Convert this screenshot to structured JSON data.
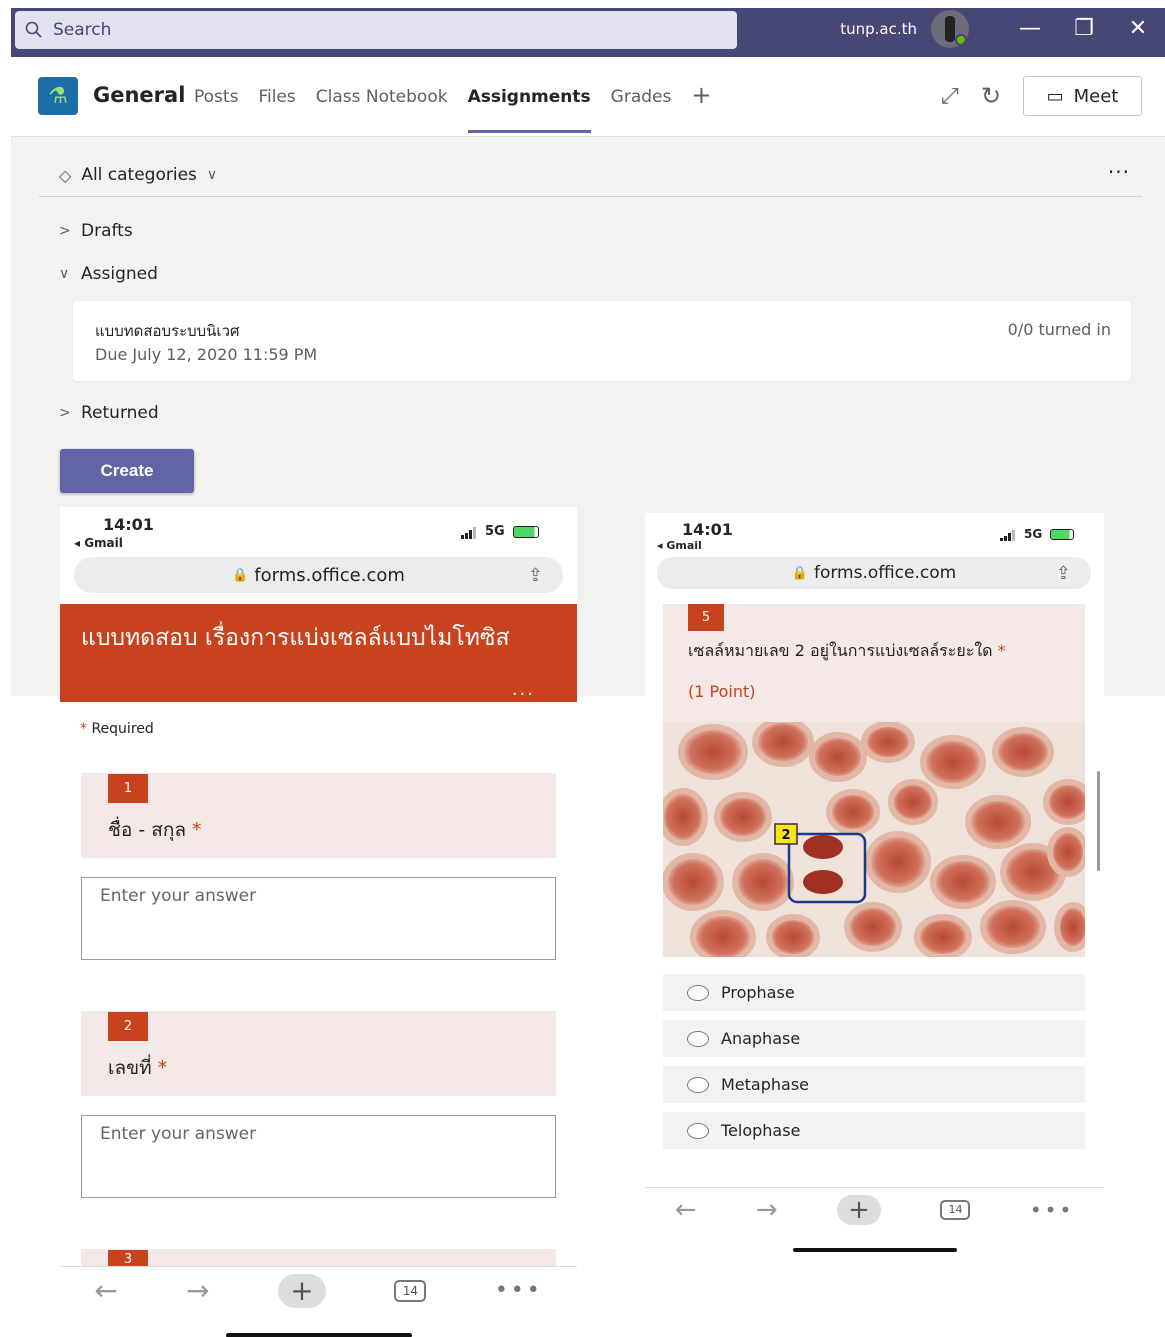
{
  "titlebar": {
    "search_placeholder": "Search",
    "org": "tunp.ac.th",
    "minimize": "—",
    "restore": "❐",
    "close": "✕"
  },
  "header": {
    "channel": "General",
    "tabs": [
      "Posts",
      "Files",
      "Class Notebook",
      "Assignments",
      "Grades"
    ],
    "active_tab": "Assignments",
    "meet_label": "Meet"
  },
  "filter": {
    "label": "All categories"
  },
  "sections": {
    "drafts": "Drafts",
    "assigned": "Assigned",
    "returned": "Returned"
  },
  "assignment": {
    "title": "แบบทดสอบระบบนิเวศ",
    "due": "Due July 12, 2020 11:59 PM",
    "status": "0/0 turned in"
  },
  "create_label": "Create",
  "phone_left": {
    "time": "14:01",
    "back_app": "◂ Gmail",
    "network": "5G",
    "url": "forms.office.com",
    "banner_title": "แบบทดสอบ เรื่องการแบ่งเซลล์แบบไมโทซิส",
    "banner_more": "...",
    "required_note": "Required",
    "questions": [
      {
        "num": "1",
        "text": "ชื่อ - สกุล",
        "placeholder": "Enter your answer"
      },
      {
        "num": "2",
        "text": "เลขที่",
        "placeholder": "Enter your answer"
      },
      {
        "num": "3"
      }
    ],
    "tab_count": "14"
  },
  "phone_right": {
    "time": "14:01",
    "back_app": "◂ Gmail",
    "network": "5G",
    "url": "forms.office.com",
    "question": {
      "num": "5",
      "text": "เซลล์หมายเลข 2 อยู่ในการแบ่งเซลล์ระยะใด",
      "points": "(1 Point)",
      "image_label": "2",
      "options": [
        "Prophase",
        "Anaphase",
        "Metaphase",
        "Telophase"
      ]
    },
    "tab_count": "14"
  },
  "colors": {
    "teams_purple": "#464775",
    "accent": "#6264a7",
    "forms_red": "#c7421d"
  }
}
